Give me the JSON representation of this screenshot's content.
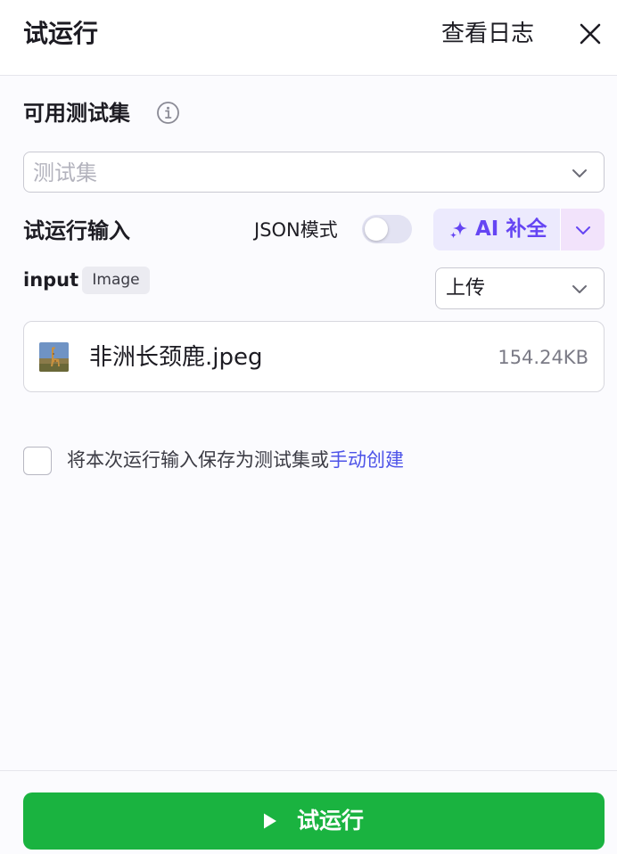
{
  "header": {
    "title": "试运行",
    "view_logs": "查看日志",
    "close_icon": "close-icon"
  },
  "testset": {
    "label": "可用测试集",
    "info_icon": "info-icon",
    "placeholder": "测试集"
  },
  "run_input": {
    "label": "试运行输入",
    "json_mode_label": "JSON模式",
    "json_mode_on": false,
    "ai_complete_label": "AI 补全",
    "ai_icon": "sparkle-icon",
    "colors": {
      "ai_text": "#6545f3",
      "ai_bg": "#eceafd",
      "ai_dropdown_bg": "#f2e3fb"
    }
  },
  "field": {
    "name": "input",
    "type": "Image",
    "source_select": "上传",
    "file": {
      "name": "非洲长颈鹿.jpeg",
      "size": "154.24KB",
      "thumbnail_icon": "giraffe-image-thumbnail"
    }
  },
  "save_option": {
    "checked": false,
    "text": "将本次运行输入保存为测试集或",
    "link": "手动创建",
    "link_color": "#4d53e8"
  },
  "footer": {
    "run_label": "试运行",
    "play_icon": "play-icon",
    "button_color": "#1ab340"
  }
}
